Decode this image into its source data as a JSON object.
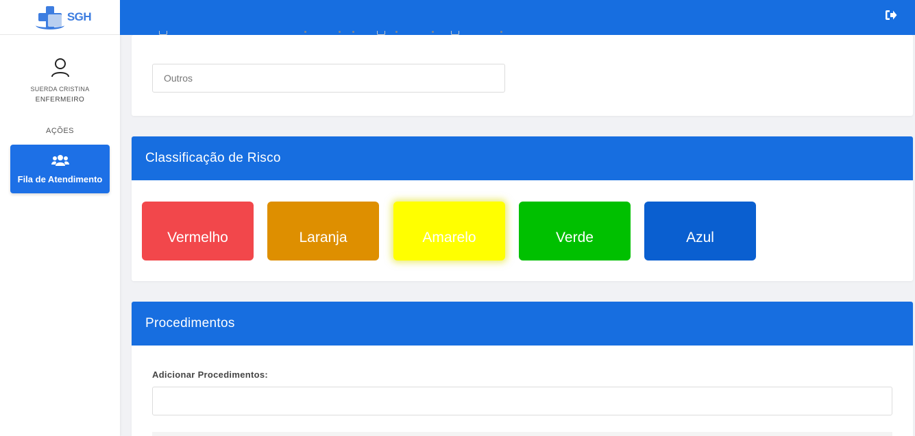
{
  "app": {
    "logo_text": "SGH"
  },
  "sidebar": {
    "user_name": "SUERDA CRISTINA",
    "user_role": "ENFERMEIRO",
    "section_label": "AÇÕES",
    "nav_button_label": "Fila de Atendimento"
  },
  "form": {
    "outros_placeholder": "Outros"
  },
  "risk": {
    "title": "Classificação de Risco",
    "options": [
      {
        "label": "Vermelho",
        "color": "#f2474b"
      },
      {
        "label": "Laranja",
        "color": "#de8f00"
      },
      {
        "label": "Amarelo",
        "color": "#ffff00"
      },
      {
        "label": "Verde",
        "color": "#00c000"
      },
      {
        "label": "Azul",
        "color": "#0a5fd0"
      }
    ]
  },
  "procedures": {
    "title": "Procedimentos",
    "add_label": "Adicionar Procedimentos:",
    "add_value": ""
  },
  "colors": {
    "primary": "#176ee0"
  }
}
